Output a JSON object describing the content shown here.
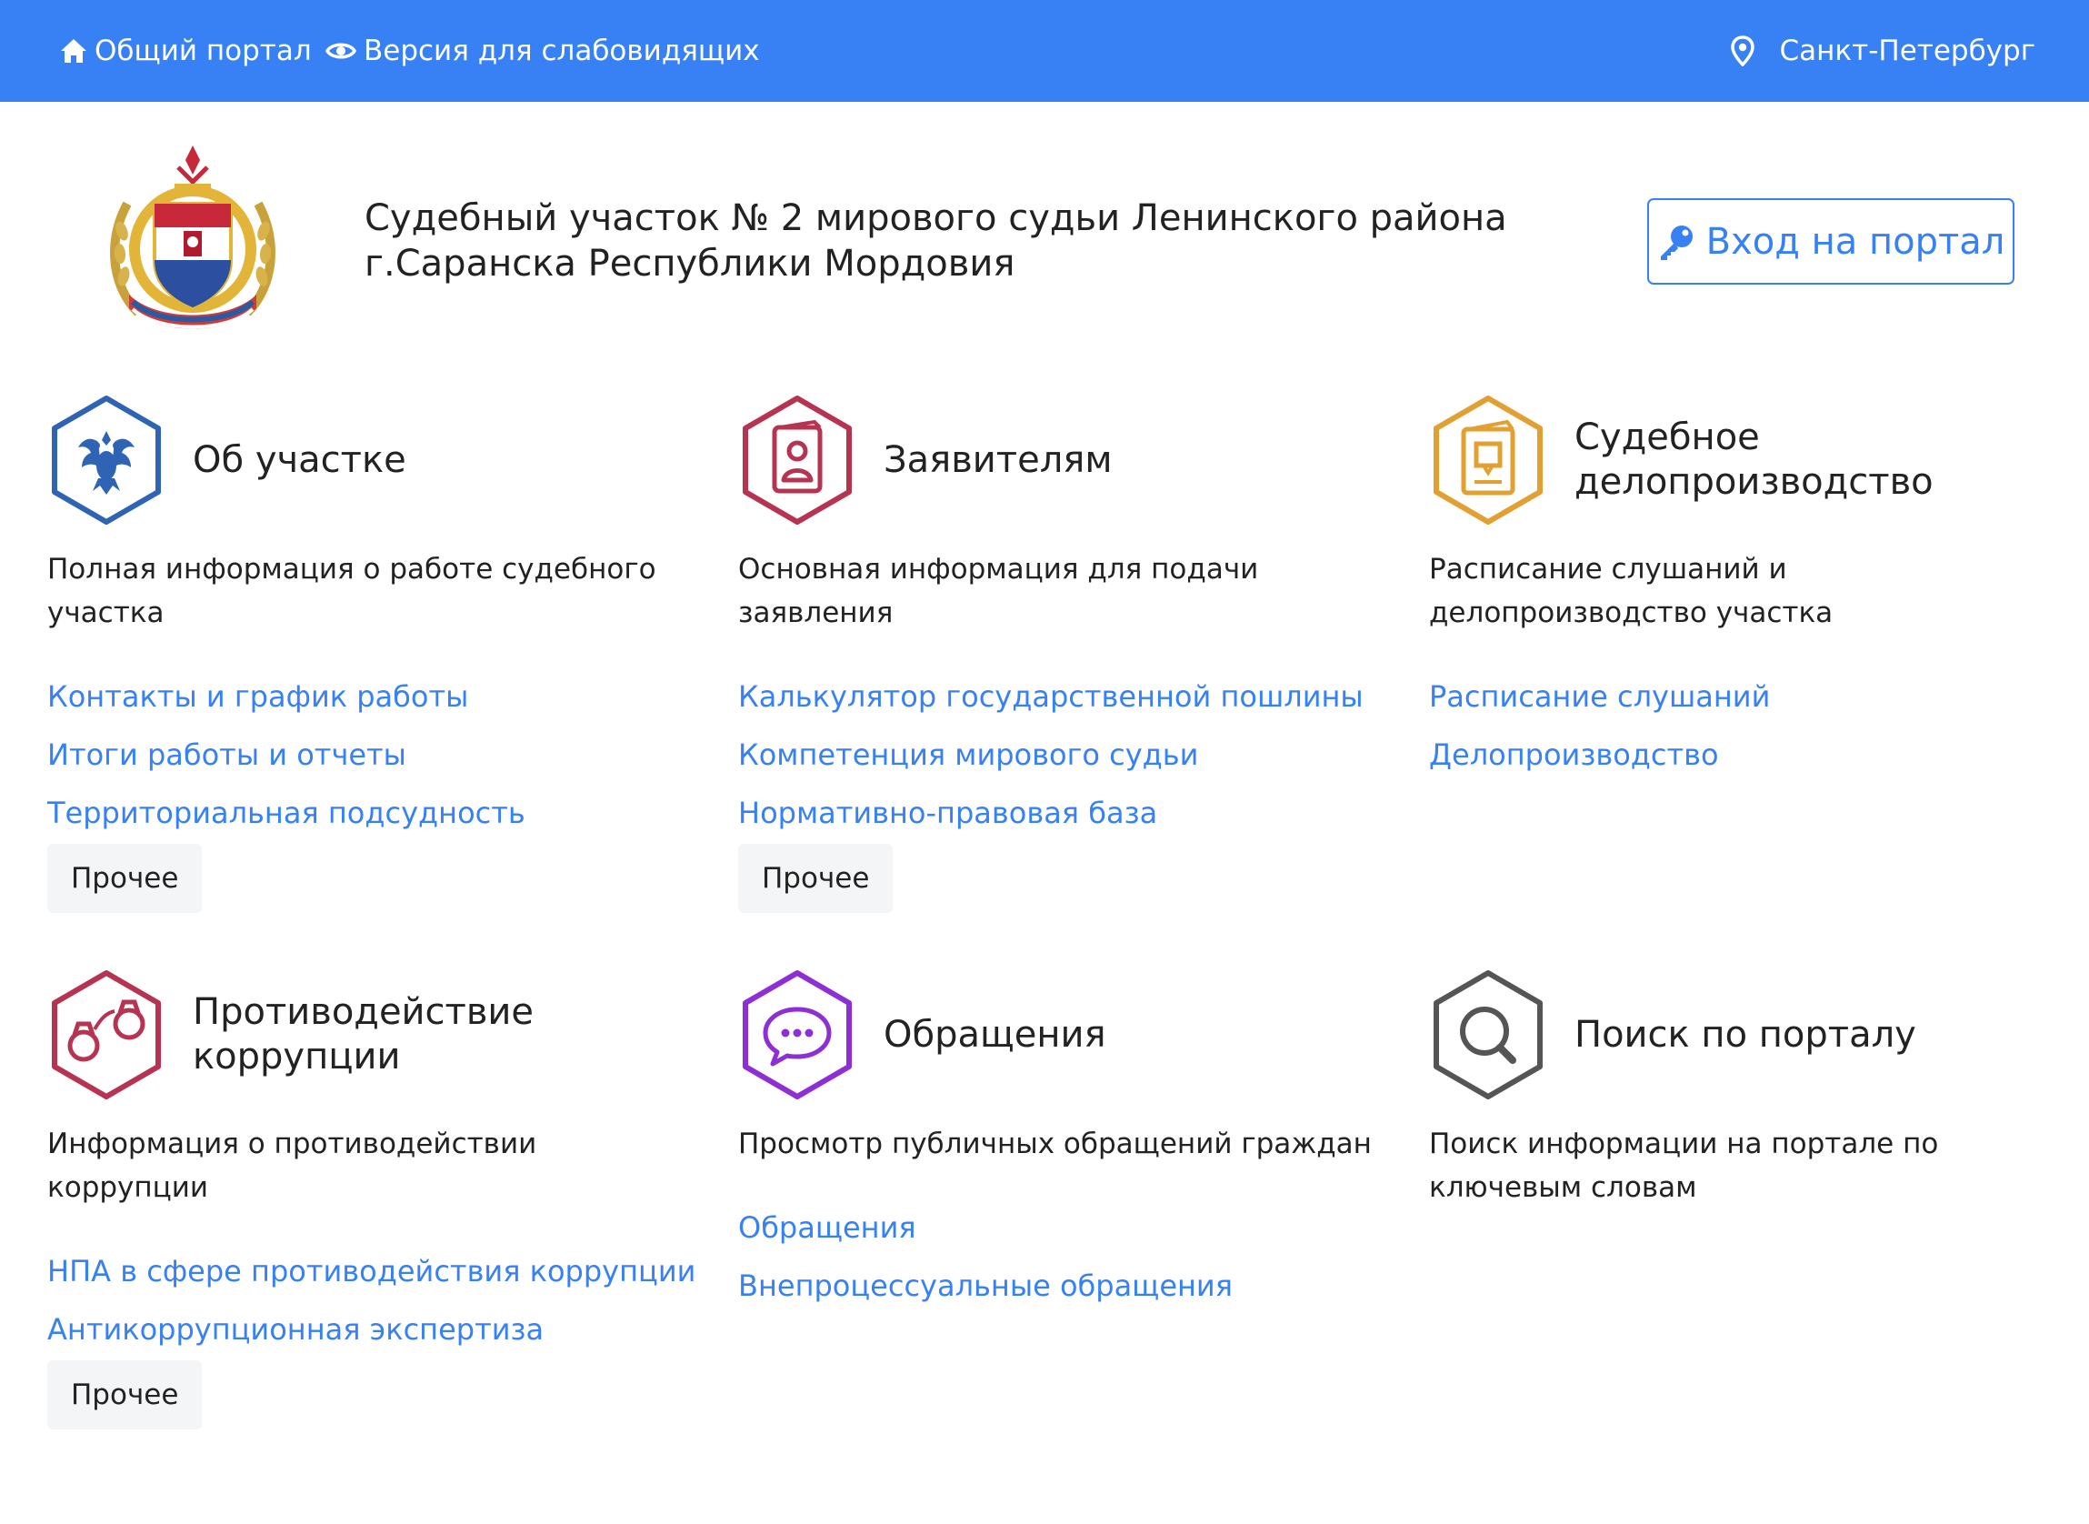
{
  "topbar": {
    "portal_label": "Общий портал",
    "vision_label": "Версия для слабовидящих",
    "city_label": "Санкт-Петербург"
  },
  "header": {
    "title": "Судебный участок № 2 мирового судьи Ленинского района г.Саранска Республики Мордовия",
    "login_label": "Вход на портал"
  },
  "colors": {
    "topbar": "#3781f5",
    "link": "#3781f5",
    "icon_about": "#2f64b5",
    "icon_applicants": "#b63452",
    "icon_records": "#e3a032",
    "icon_anticorruption": "#b63452",
    "icon_appeals": "#8e2fd5",
    "icon_search": "#555555"
  },
  "sections": [
    {
      "title": "Об участке",
      "icon": "russian-eagle-icon",
      "description": "Полная информация о работе судебного участка",
      "links": [
        "Контакты и график работы",
        "Итоги работы и отчеты",
        "Территориальная подсудность"
      ],
      "more": "Прочее"
    },
    {
      "title": "Заявителям",
      "icon": "person-document-icon",
      "description": "Основная информация для подачи заявления",
      "links": [
        "Калькулятор государственной пошлины",
        "Компетенция мирового судьи",
        "Нормативно-правовая база"
      ],
      "more": "Прочее"
    },
    {
      "title": "Судебное делопроизводство",
      "icon": "document-folder-icon",
      "description": "Расписание слушаний и делопроизводство участка",
      "links": [
        "Расписание слушаний",
        "Делопроизводство"
      ]
    },
    {
      "title": "Противодействие коррупции",
      "icon": "handcuffs-icon",
      "description": "Информация о противодействии коррупции",
      "links": [
        "НПА в сфере противодействия коррупции",
        "Антикоррупционная экспертиза"
      ],
      "more": "Прочее"
    },
    {
      "title": "Обращения",
      "icon": "chat-bubble-icon",
      "description": "Просмотр публичных обращений граждан",
      "links": [
        "Обращения",
        "Внепроцессуальные обращения"
      ]
    },
    {
      "title": "Поиск по порталу",
      "icon": "magnifier-icon",
      "description": "Поиск информации на портале по ключевым словам",
      "links": []
    }
  ]
}
